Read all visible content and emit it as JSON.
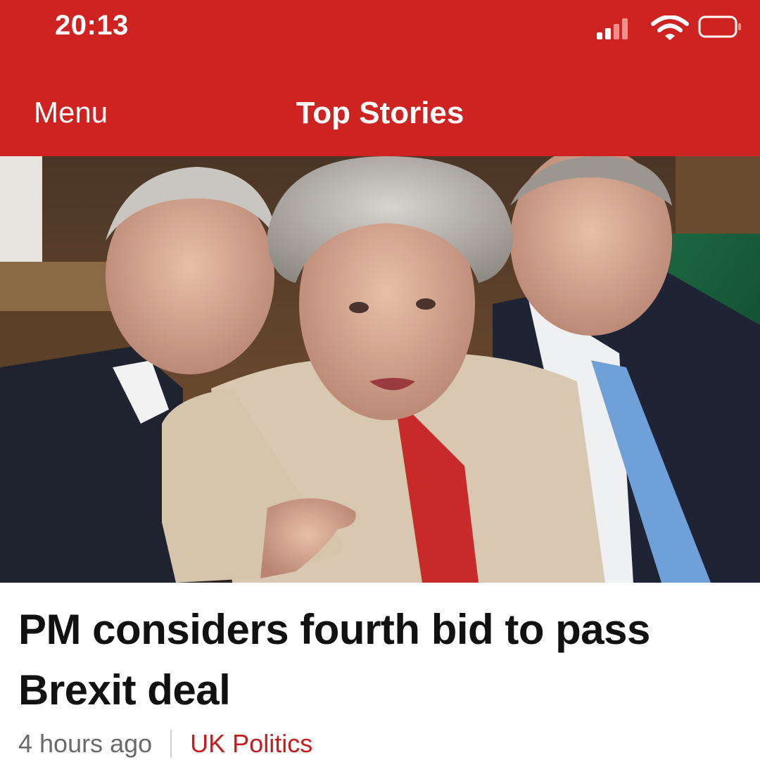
{
  "status_bar": {
    "time": "20:13",
    "icons": [
      "cellular-signal-icon",
      "wifi-icon",
      "battery-icon"
    ]
  },
  "nav": {
    "menu_label": "Menu",
    "title": "Top Stories"
  },
  "story": {
    "headline": "PM considers fourth bid to pass Brexit deal",
    "timestamp": "4 hours ago",
    "category": "UK Politics"
  },
  "colors": {
    "brand_red": "#cf2321",
    "category_red": "#c91a1f",
    "meta_grey": "#6a6a6a"
  }
}
